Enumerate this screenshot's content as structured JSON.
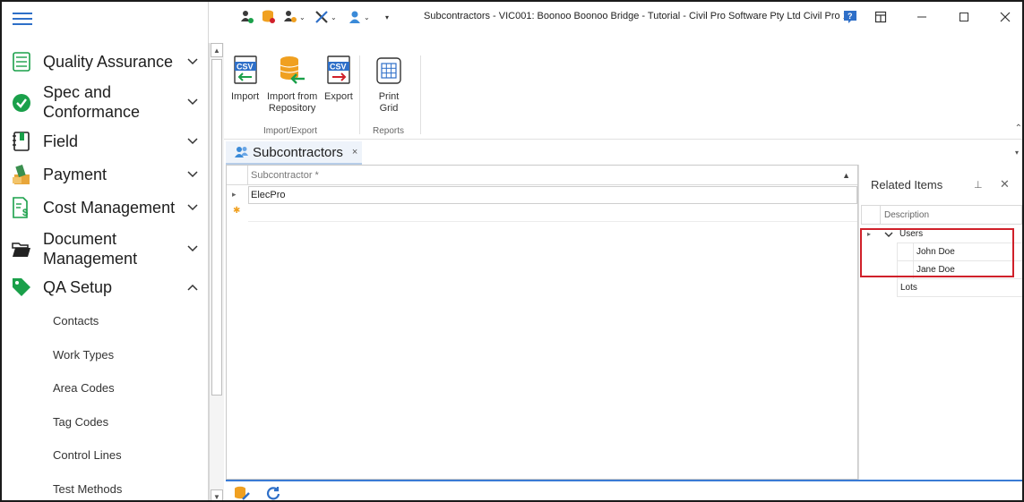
{
  "window": {
    "title": "Subcontractors - VIC001: Boonoo Boonoo Bridge - Tutorial - Civil Pro Software Pty Ltd Civil Pro 11"
  },
  "sidebar": {
    "items": [
      {
        "label": "Quality Assurance",
        "icon": "checklist-icon",
        "expanded": false
      },
      {
        "label": "Spec and\nConformance",
        "icon": "check-circle-icon",
        "expanded": false
      },
      {
        "label": "Field",
        "icon": "notebook-icon",
        "expanded": false
      },
      {
        "label": "Payment",
        "icon": "payment-icon",
        "expanded": false
      },
      {
        "label": "Cost Management",
        "icon": "cost-document-icon",
        "expanded": false
      },
      {
        "label": "Document\nManagement",
        "icon": "folder-open-icon",
        "expanded": false
      },
      {
        "label": "QA Setup",
        "icon": "tag-icon",
        "expanded": true
      }
    ],
    "sub_items": [
      "Contacts",
      "Work Types",
      "Area Codes",
      "Tag Codes",
      "Control Lines",
      "Test Methods"
    ]
  },
  "ribbon": {
    "import_export_group": {
      "label": "Import/Export",
      "buttons": [
        "Import",
        "Import from\nRepository",
        "Export"
      ]
    },
    "reports_group": {
      "label": "Reports",
      "buttons": [
        "Print\nGrid"
      ]
    }
  },
  "doc_tab": {
    "label": "Subcontractors",
    "close": "×"
  },
  "grid": {
    "column_header": "Subcontractor *",
    "rows": [
      "ElecPro"
    ]
  },
  "related": {
    "title": "Related Items",
    "column_header": "Description",
    "tree": {
      "users_label": "Users",
      "users": [
        "John  Doe",
        "Jane Doe"
      ],
      "lots_label": "Lots"
    }
  },
  "colors": {
    "accent": "#2e6fc8",
    "highlight": "#d0202a",
    "green": "#1aa04a"
  }
}
